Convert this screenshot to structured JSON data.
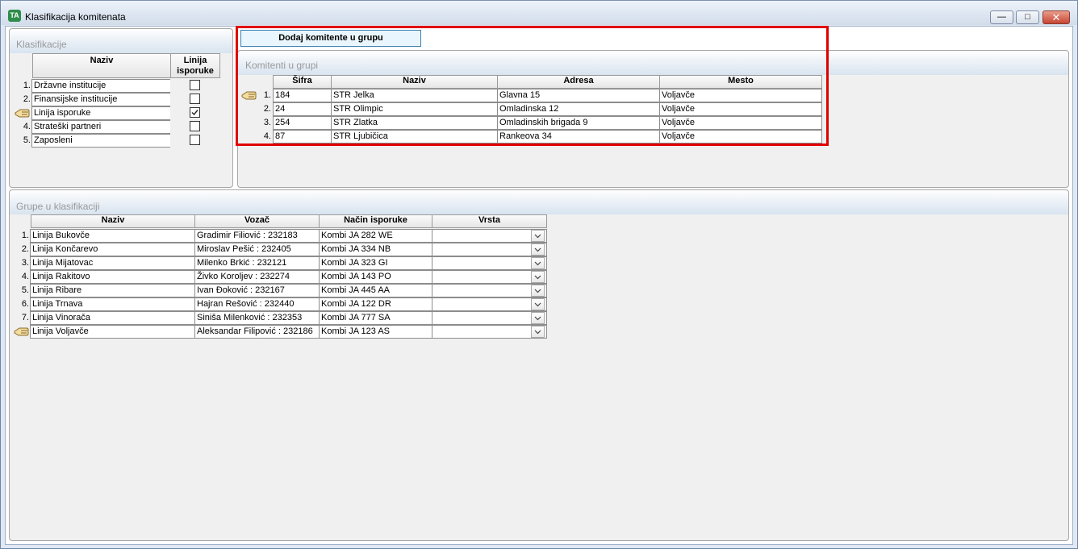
{
  "window": {
    "title": "Klasifikacija komitenata",
    "icon_text": "TA"
  },
  "klasifikacije": {
    "title": "Klasifikacije",
    "headers": {
      "naziv": "Naziv",
      "linija_line1": "Linija",
      "linija_line2": "isporuke"
    },
    "rows": [
      {
        "num": "1.",
        "naziv": "Državne institucije",
        "checked": false,
        "current": false
      },
      {
        "num": "2.",
        "naziv": "Finansijske institucije",
        "checked": false,
        "current": false
      },
      {
        "num": "",
        "naziv": "Linija isporuke",
        "checked": true,
        "current": true
      },
      {
        "num": "4.",
        "naziv": "Strateški partneri",
        "checked": false,
        "current": false
      },
      {
        "num": "5.",
        "naziv": "Zaposleni",
        "checked": false,
        "current": false
      }
    ]
  },
  "toolbar": {
    "add_button": "Dodaj komitente u grupu"
  },
  "komitenti": {
    "title": "Komitenti u grupi",
    "headers": {
      "sifra": "Šifra",
      "naziv": "Naziv",
      "adresa": "Adresa",
      "mesto": "Mesto"
    },
    "rows": [
      {
        "num": "1.",
        "sifra": "184",
        "naziv": "STR Jelka",
        "adresa": "Glavna 15",
        "mesto": "Voljavče",
        "current": true
      },
      {
        "num": "2.",
        "sifra": "24",
        "naziv": "STR Olimpic",
        "adresa": "Omladinska 12",
        "mesto": "Voljavče",
        "current": false
      },
      {
        "num": "3.",
        "sifra": "254",
        "naziv": "STR Zlatka",
        "adresa": "Omladinskih brigada 9",
        "mesto": "Voljavče",
        "current": false
      },
      {
        "num": "4.",
        "sifra": "87",
        "naziv": "STR Ljubičica",
        "adresa": "Rankeova 34",
        "mesto": "Voljavče",
        "current": false
      }
    ]
  },
  "grupe": {
    "title": "Grupe u klasifikaciji",
    "headers": {
      "naziv": "Naziv",
      "vozac": "Vozač",
      "nacin": "Način isporuke",
      "vrsta": "Vrsta"
    },
    "rows": [
      {
        "num": "1.",
        "naziv": "Linija Bukovče",
        "vozac": "Gradimir Filiović : 232183",
        "nacin": "Kombi JA 282 WE",
        "vrsta": "",
        "current": false
      },
      {
        "num": "2.",
        "naziv": "Linija Končarevo",
        "vozac": "Miroslav Pešić : 232405",
        "nacin": "Kombi JA 334 NB",
        "vrsta": "",
        "current": false
      },
      {
        "num": "3.",
        "naziv": "Linija Mijatovac",
        "vozac": "Milenko Brkić : 232121",
        "nacin": "Kombi JA 323 GI",
        "vrsta": "",
        "current": false
      },
      {
        "num": "4.",
        "naziv": "Linija Rakitovo",
        "vozac": "Živko Koroljev : 232274",
        "nacin": "Kombi JA 143 PO",
        "vrsta": "",
        "current": false
      },
      {
        "num": "5.",
        "naziv": "Linija Ribare",
        "vozac": "Ivan Đoković : 232167",
        "nacin": "Kombi JA 445 AA",
        "vrsta": "",
        "current": false
      },
      {
        "num": "6.",
        "naziv": "Linija Trnava",
        "vozac": "Hajran Rešović : 232440",
        "nacin": "Kombi JA 122 DR",
        "vrsta": "",
        "current": false
      },
      {
        "num": "7.",
        "naziv": "Linija Vinorača",
        "vozac": "Siniša Milenković : 232353",
        "nacin": "Kombi JA 777 SA",
        "vrsta": "",
        "current": false
      },
      {
        "num": "",
        "naziv": "Linija Voljavče",
        "vozac": "Aleksandar Filipović : 232186",
        "nacin": "Kombi JA 123 AS",
        "vrsta": "",
        "current": true
      }
    ]
  },
  "colors": {
    "highlight": "#e00000",
    "button_bg": "#eaf6fd",
    "button_border": "#3c7fb1"
  }
}
